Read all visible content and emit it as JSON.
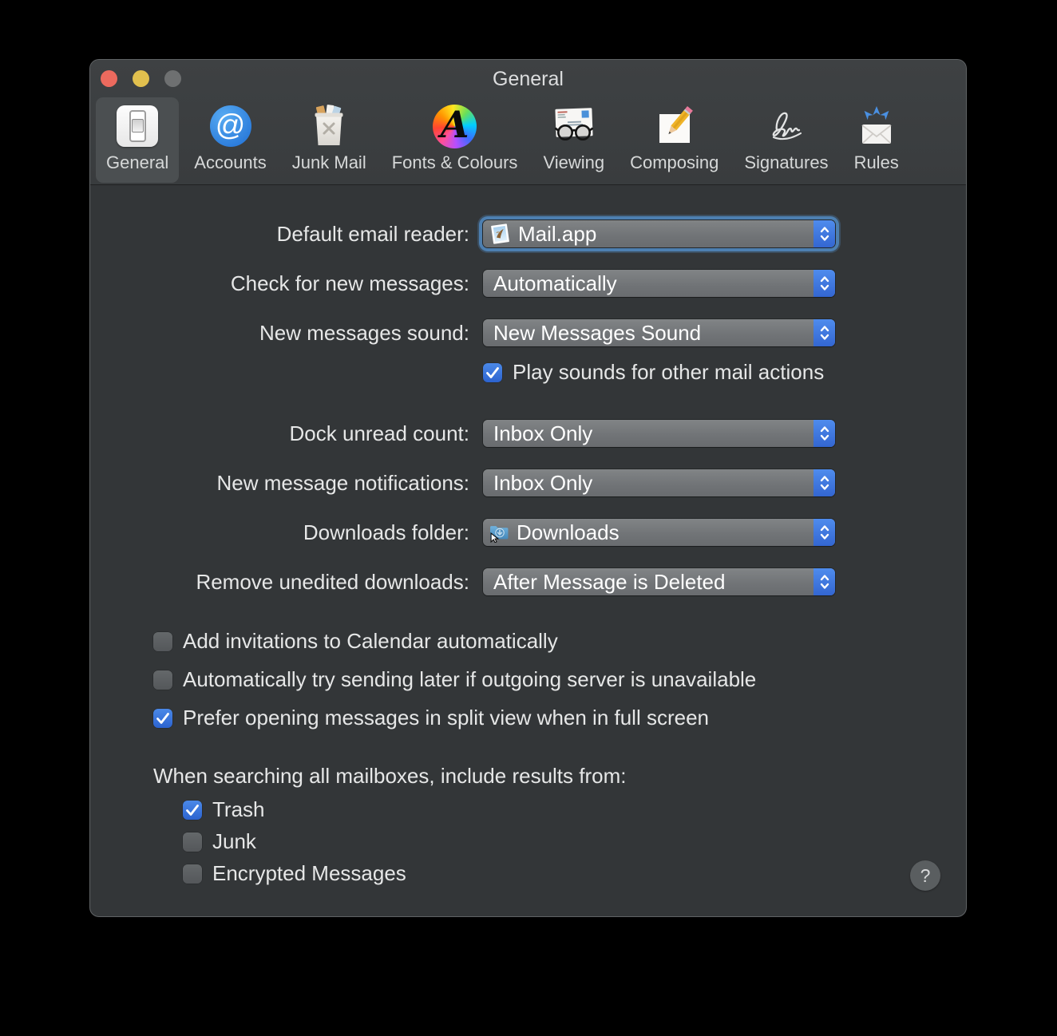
{
  "window": {
    "title": "General",
    "help_glyph": "?"
  },
  "toolbar": {
    "items": [
      {
        "label": "General",
        "icon": "general-switch-icon",
        "selected": true
      },
      {
        "label": "Accounts",
        "icon": "at-sign-icon",
        "selected": false
      },
      {
        "label": "Junk Mail",
        "icon": "trash-bin-icon",
        "selected": false
      },
      {
        "label": "Fonts & Colours",
        "icon": "letter-a-rainbow-icon",
        "selected": false
      },
      {
        "label": "Viewing",
        "icon": "envelope-glasses-icon",
        "selected": false
      },
      {
        "label": "Composing",
        "icon": "page-pencil-icon",
        "selected": false
      },
      {
        "label": "Signatures",
        "icon": "signature-icon",
        "selected": false
      },
      {
        "label": "Rules",
        "icon": "envelope-arrows-icon",
        "selected": false
      }
    ]
  },
  "icons": {
    "at_glyph": "@",
    "fonts_glyph": "A"
  },
  "form": {
    "selects": [
      {
        "label": "Default email reader:",
        "value": "Mail.app",
        "icon": "mail-app-stamp-icon",
        "focused": true
      },
      {
        "label": "Check for new messages:",
        "value": "Automatically",
        "focused": false
      },
      {
        "label": "New messages sound:",
        "value": "New Messages Sound",
        "focused": false
      },
      {
        "label": "Dock unread count:",
        "value": "Inbox Only",
        "focused": false
      },
      {
        "label": "New message notifications:",
        "value": "Inbox Only",
        "focused": false
      },
      {
        "label": "Downloads folder:",
        "value": "Downloads",
        "icon": "downloads-folder-icon",
        "focused": false
      },
      {
        "label": "Remove unedited downloads:",
        "value": "After Message is Deleted",
        "focused": false
      }
    ],
    "play_sounds": {
      "label": "Play sounds for other mail actions",
      "checked": true
    },
    "options": [
      {
        "label": "Add invitations to Calendar automatically",
        "checked": false
      },
      {
        "label": "Automatically try sending later if outgoing server is unavailable",
        "checked": false
      },
      {
        "label": "Prefer opening messages in split view when in full screen",
        "checked": true
      }
    ],
    "search": {
      "heading": "When searching all mailboxes, include results from:",
      "options": [
        {
          "label": "Trash",
          "checked": true
        },
        {
          "label": "Junk",
          "checked": false
        },
        {
          "label": "Encrypted Messages",
          "checked": false
        }
      ]
    }
  },
  "colors": {
    "accent_blue": "#3a76dd",
    "checkbox_checked_blue": "#2f6bd6",
    "focus_ring_blue": "#4d7fb0",
    "traffic_red": "#ec6a5e",
    "traffic_yellow": "#e1c04e",
    "traffic_gray": "#6e7071",
    "toolbar_bg": "#3b3e40",
    "content_bg": "#333638"
  }
}
